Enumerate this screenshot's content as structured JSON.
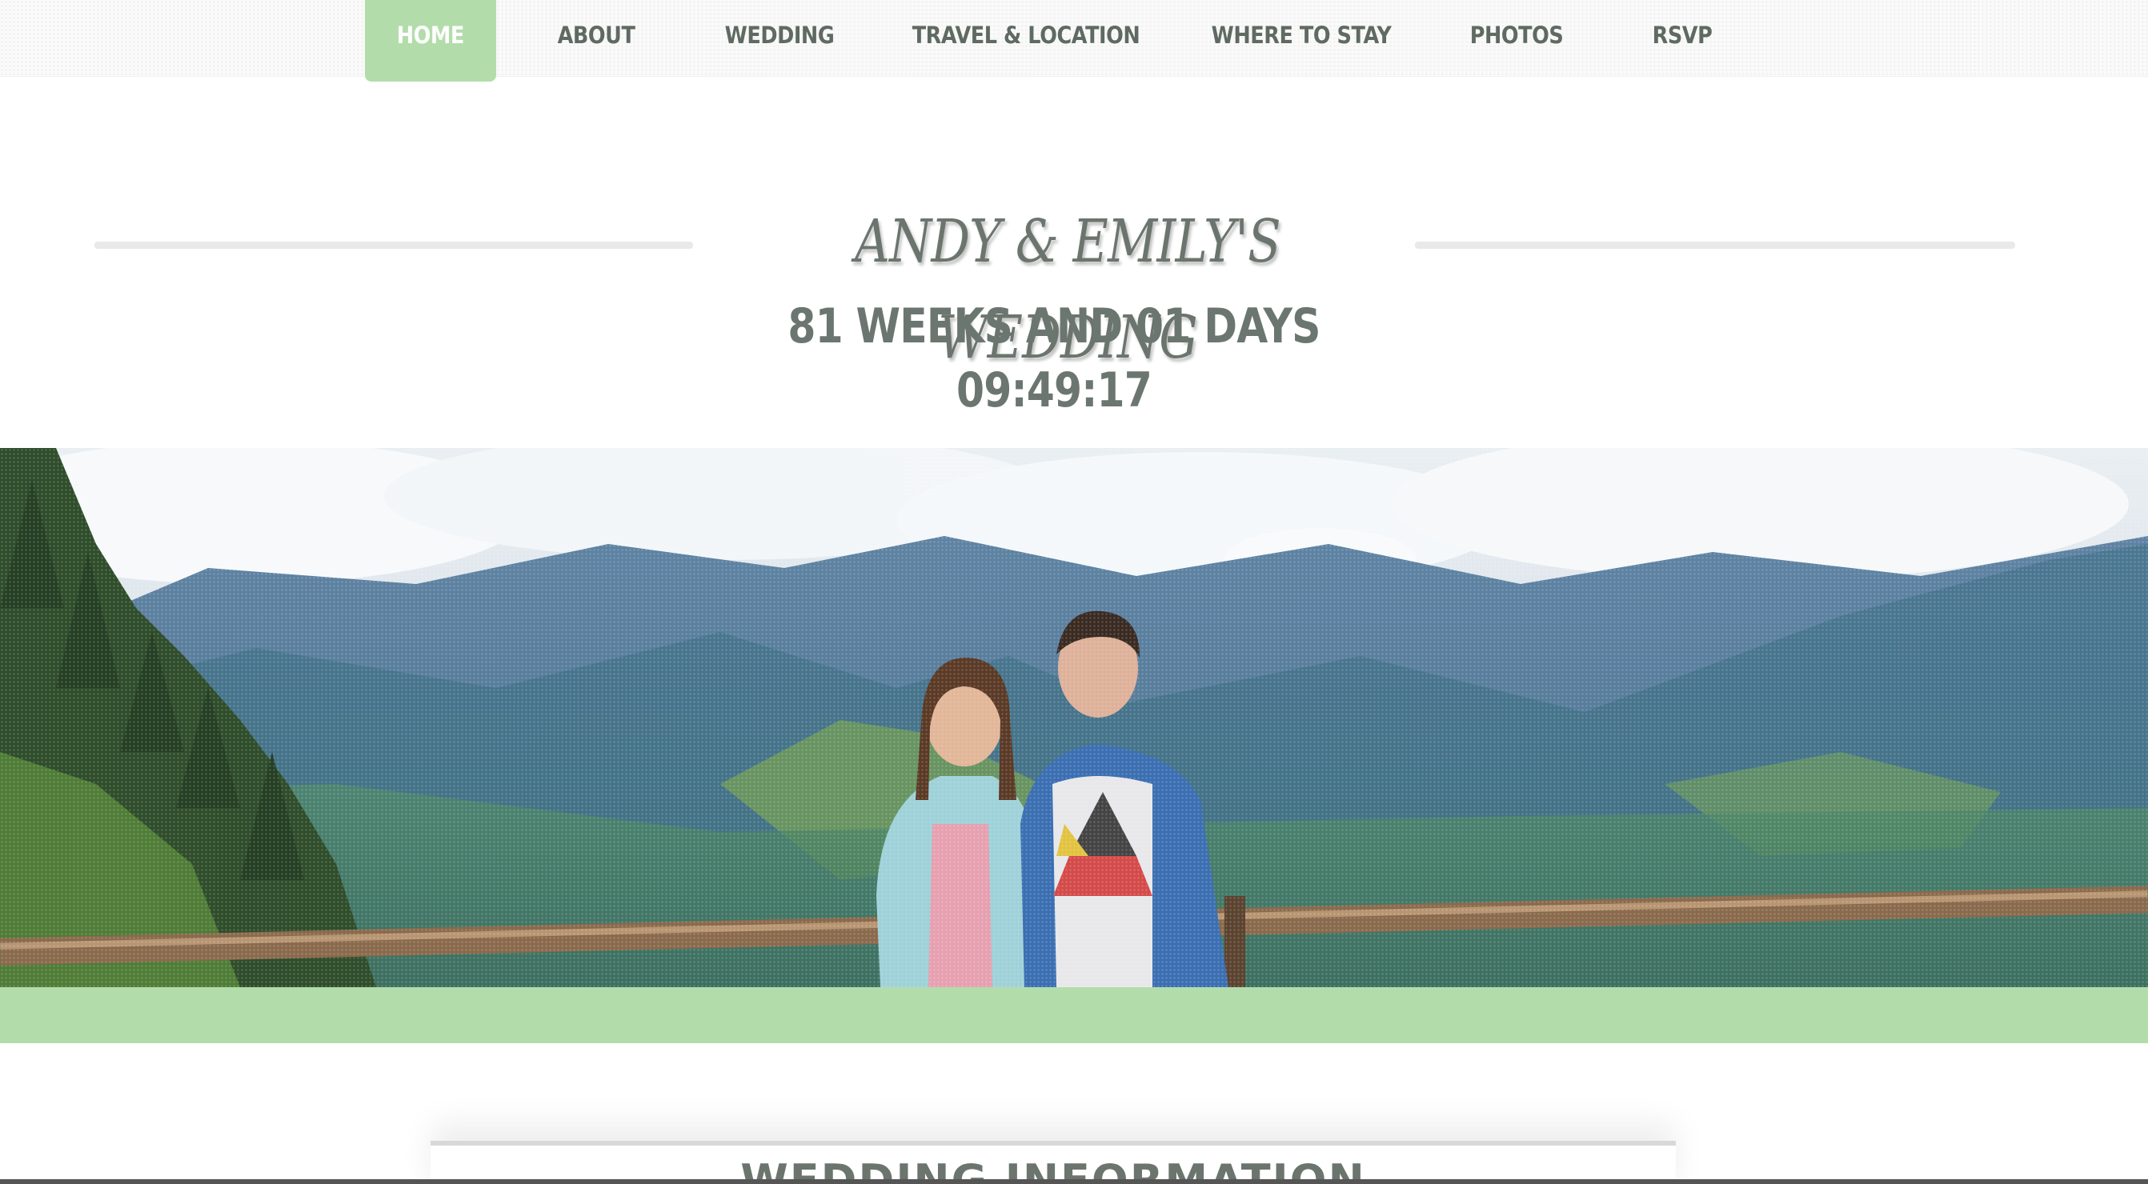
{
  "nav": {
    "items": [
      {
        "label": "HOME",
        "active": true
      },
      {
        "label": "ABOUT",
        "active": false
      },
      {
        "label": "WEDDING",
        "active": false
      },
      {
        "label": "TRAVEL & LOCATION",
        "active": false
      },
      {
        "label": "WHERE TO STAY",
        "active": false
      },
      {
        "label": "PHOTOS",
        "active": false
      },
      {
        "label": "RSVP",
        "active": false
      }
    ]
  },
  "header": {
    "title": "ANDY & EMILY'S WEDDING",
    "countdown": "81 WEEKS AND 01 DAYS 09:49:17"
  },
  "section": {
    "title": "WEDDING INFORMATION"
  },
  "colors": {
    "accent": "#b2ddab",
    "text": "#6b756e",
    "nav_text": "#5f6a62"
  }
}
